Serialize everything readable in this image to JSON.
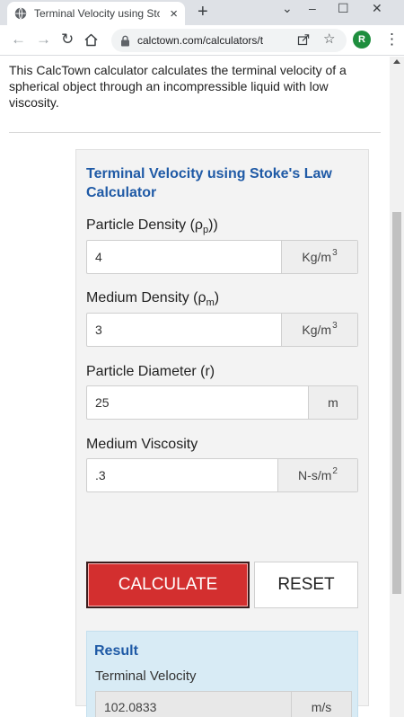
{
  "browser": {
    "tab_title": "Terminal Velocity using Stoke",
    "tab_close": "×",
    "new_tab": "+",
    "window_controls": {
      "chevron": "⌄",
      "minimize": "–",
      "maximize": "☐",
      "close": "✕"
    },
    "url": "calctown.com/calculators/t...",
    "profile_initial": "R",
    "icons": [
      "back-icon",
      "forward-icon",
      "reload-icon",
      "home-icon",
      "lock-icon",
      "share-icon",
      "star-icon",
      "menu-icon"
    ]
  },
  "page": {
    "intro": "This CalcTown calculator calculates the terminal velocity of a spherical object through an incompressible liquid with low viscosity."
  },
  "calculator": {
    "title": "Terminal Velocity using Stoke's Law Calculator",
    "fields": [
      {
        "label": "Particle Density (ρ",
        "label_sub": "p",
        "label_end": "))",
        "value": "4",
        "unit": "Kg/m",
        "unit_sup": "3"
      },
      {
        "label": "Medium Density (ρ",
        "label_sub": "m",
        "label_end": ")",
        "value": "3",
        "unit": "Kg/m",
        "unit_sup": "3"
      },
      {
        "label": "Particle Diameter (r)",
        "value": "25",
        "unit": "m"
      },
      {
        "label": "Medium Viscosity",
        "value": ".3",
        "unit": "N-s/m",
        "unit_sup": "2"
      }
    ],
    "calculate_label": "CALCULATE",
    "reset_label": "RESET",
    "result": {
      "heading": "Result",
      "label": "Terminal Velocity",
      "value": "102.0833",
      "unit": "m/s"
    }
  },
  "colors": {
    "accent": "#1f5aa6",
    "calculate_button": "#d32f2f",
    "result_panel": "#d8ebf5",
    "profile_avatar": "#1e8e3e"
  }
}
